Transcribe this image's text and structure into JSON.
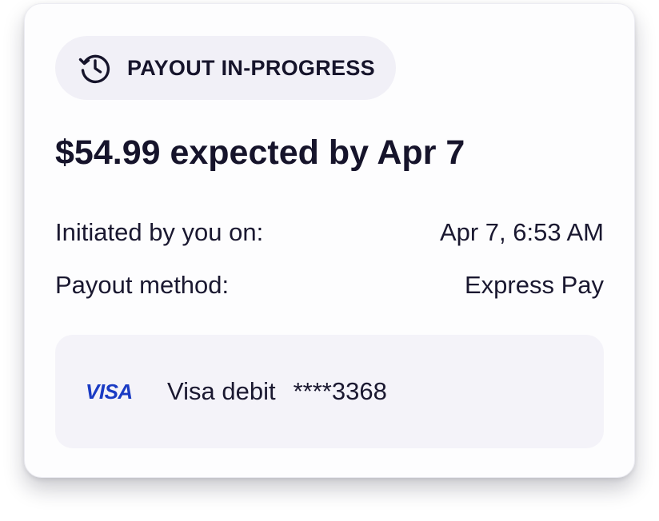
{
  "status": {
    "label": "PAYOUT IN-PROGRESS",
    "icon": "history-icon"
  },
  "headline": "$54.99 expected by Apr 7",
  "details": {
    "initiated_label": "Initiated by you on:",
    "initiated_value": "Apr 7, 6:53 AM",
    "method_label": "Payout method:",
    "method_value": "Express Pay"
  },
  "payment_method": {
    "logo_text": "VISA",
    "name": "Visa debit",
    "number": "****3368",
    "logo_color": "#1a3bc4"
  }
}
